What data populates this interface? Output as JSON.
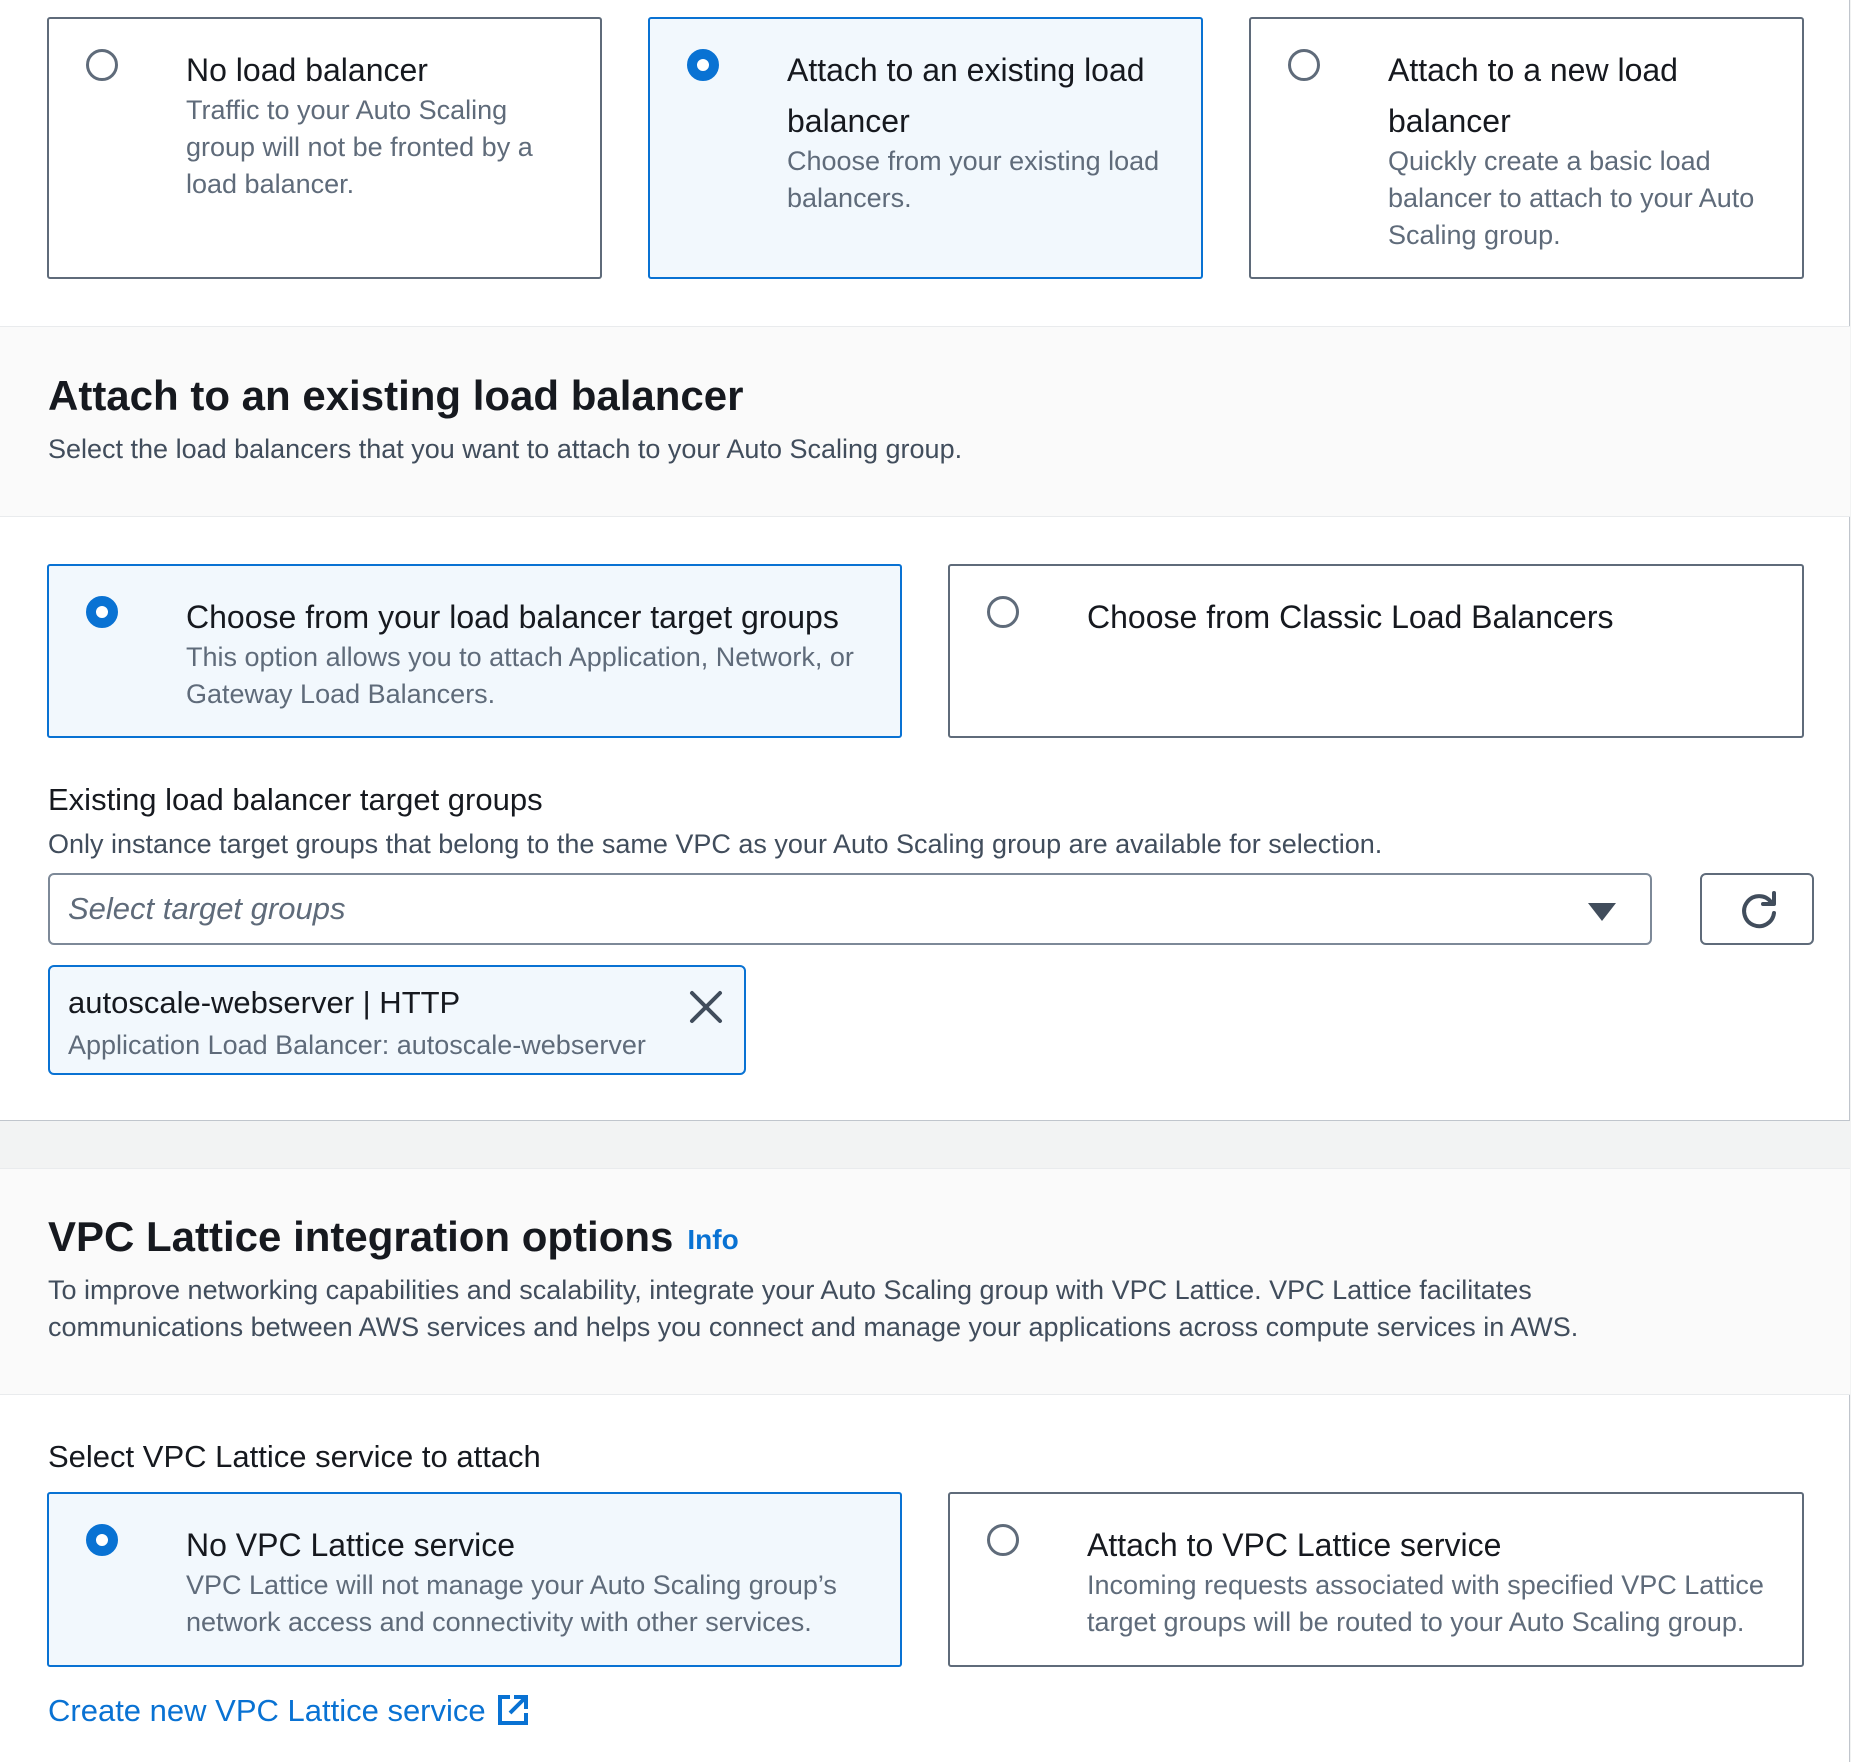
{
  "lb_options": [
    {
      "title": "No load balancer",
      "desc": "Traffic to your Auto Scaling group will not be fronted by a load balancer.",
      "selected": false
    },
    {
      "title": "Attach to an existing load balancer",
      "desc": "Choose from your existing load balancers.",
      "selected": true
    },
    {
      "title": "Attach to a new load balancer",
      "desc": "Quickly create a basic load balancer to attach to your Auto Scaling group.",
      "selected": false
    }
  ],
  "existing_lb": {
    "heading": "Attach to an existing load balancer",
    "description": "Select the load balancers that you want to attach to your Auto Scaling group.",
    "source_options": [
      {
        "title": "Choose from your load balancer target groups",
        "desc": "This option allows you to attach Application, Network, or Gateway Load Balancers.",
        "selected": true
      },
      {
        "title": "Choose from Classic Load Balancers",
        "desc": "",
        "selected": false
      }
    ],
    "target_groups_label": "Existing load balancer target groups",
    "target_groups_hint": "Only instance target groups that belong to the same VPC as your Auto Scaling group are available for selection.",
    "select_placeholder": "Select target groups",
    "selected_token": {
      "title": "autoscale-webserver | HTTP",
      "desc": "Application Load Balancer: autoscale-webserver"
    }
  },
  "vpc_lattice": {
    "heading": "VPC Lattice integration options",
    "info_label": "Info",
    "description": "To improve networking capabilities and scalability, integrate your Auto Scaling group with VPC Lattice. VPC Lattice facilitates communications between AWS services and helps you connect and manage your applications across compute services in AWS.",
    "select_label": "Select VPC Lattice service to attach",
    "options": [
      {
        "title": "No VPC Lattice service",
        "desc": "VPC Lattice will not manage your Auto Scaling group’s network access and connectivity with other services.",
        "selected": true
      },
      {
        "title": "Attach to VPC Lattice service",
        "desc": "Incoming requests associated with specified VPC Lattice target groups will be routed to your Auto Scaling group.",
        "selected": false
      }
    ],
    "create_link": "Create new VPC Lattice service"
  },
  "colors": {
    "accent": "#0972d3",
    "text": "#16191f",
    "muted": "#5f6b7a",
    "selected_bg": "#f2f8fd"
  }
}
